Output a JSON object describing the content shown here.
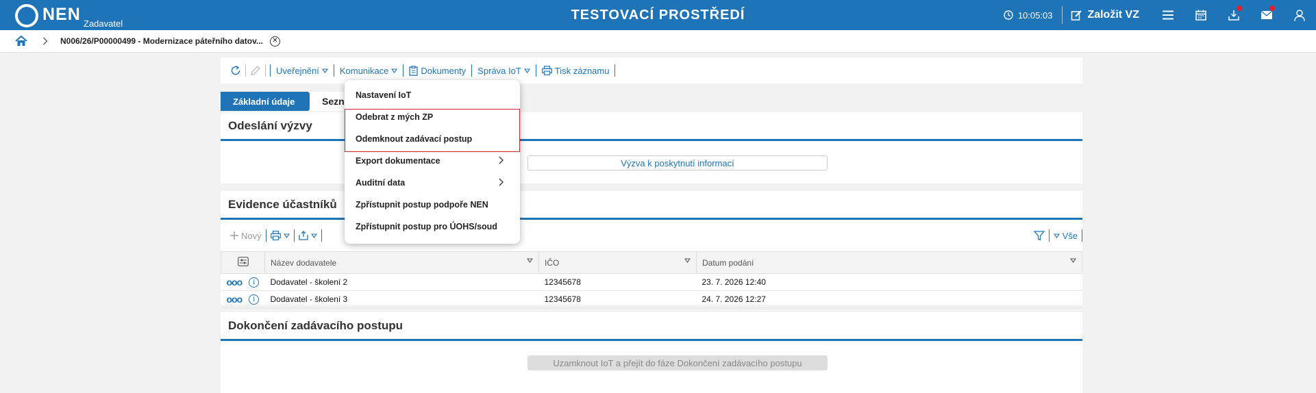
{
  "header": {
    "logo_text": "NEN",
    "logo_sub": "Zadavatel",
    "env_title": "TESTOVACÍ PROSTŘEDÍ",
    "clock": "10:05:03",
    "create_label": "Založit VZ"
  },
  "breadcrumb": {
    "title": "N006/26/P00000499 - Modernizace páteřního datov..."
  },
  "toolbar": {
    "items": [
      "Uveřejnění",
      "Komunikace",
      "Dokumenty",
      "Správa IoT",
      "Tisk záznamu"
    ]
  },
  "tabs": {
    "active": "Základní údaje",
    "second": "Sezn"
  },
  "panels": {
    "odeslani": {
      "title": "Odeslání výzvy",
      "button": "Výzva k poskytnutí informací"
    },
    "evidence": {
      "title": "Evidence účastníků",
      "new_label": "Nový",
      "filter_label": "Vše",
      "columns": [
        "Název dodavatele",
        "IČO",
        "Datum podání"
      ],
      "rows": [
        {
          "name": "Dodavatel - školení 2",
          "ico": "12345678",
          "date": "23. 7. 2026 12:40"
        },
        {
          "name": "Dodavatel - školení 3",
          "ico": "12345678",
          "date": "24. 7. 2026 12:27"
        }
      ]
    },
    "dokonceni": {
      "title": "Dokončení zadávacího postupu",
      "button": "Uzamknout IoT a přejít do fáze Dokončení zadávacího postupu"
    }
  },
  "menu": {
    "items": [
      "Nastavení IoT",
      "Odebrat z mých ZP",
      "Odemknout zadávací postup",
      "Export dokumentace",
      "Auditní data",
      "Zpřístupnit postup podpoře NEN",
      "Zpřístupnit postup pro ÚOHS/soud"
    ]
  },
  "colors": {
    "brand": "#1f74b8",
    "highlight": "#e0202e",
    "notification": "#e0202e"
  }
}
